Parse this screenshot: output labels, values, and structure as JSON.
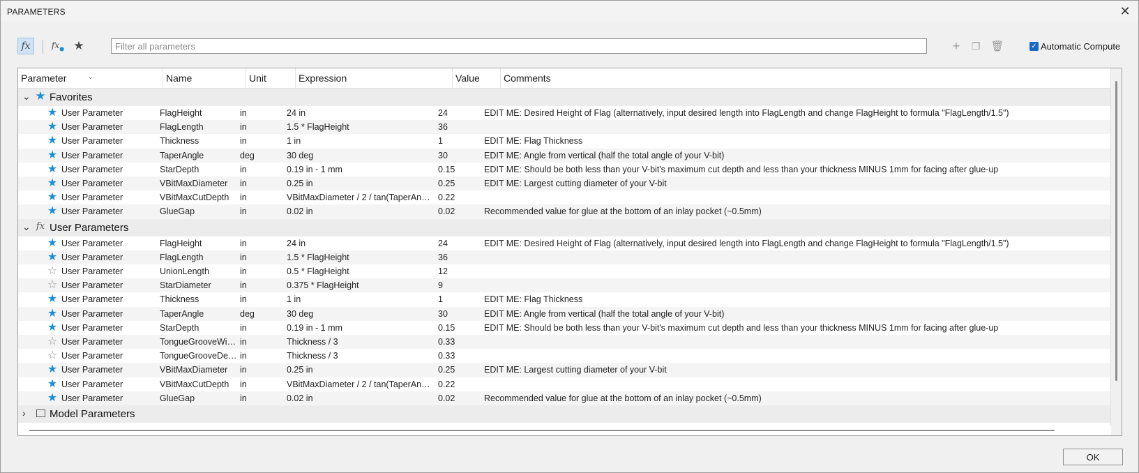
{
  "window": {
    "title": "PARAMETERS"
  },
  "toolbar": {
    "filter_placeholder": "Filter all parameters",
    "auto_compute_label": "Automatic Compute",
    "auto_compute_checked": true
  },
  "columns": [
    "Parameter",
    "Name",
    "Unit",
    "Expression",
    "Value",
    "Comments"
  ],
  "groups": [
    {
      "label": "Favorites",
      "icon": "star-icon",
      "rows": [
        {
          "fav": true,
          "param": "User Parameter",
          "name": "FlagHeight",
          "unit": "in",
          "expr": "24 in",
          "value": "24",
          "comment": "EDIT ME: Desired Height of Flag (alternatively, input desired length into FlagLength and change FlagHeight to formula \"FlagLength/1.5\")"
        },
        {
          "fav": true,
          "param": "User Parameter",
          "name": "FlagLength",
          "unit": "in",
          "expr": "1.5 * FlagHeight",
          "value": "36",
          "comment": ""
        },
        {
          "fav": true,
          "param": "User Parameter",
          "name": "Thickness",
          "unit": "in",
          "expr": "1 in",
          "value": "1",
          "comment": "EDIT ME: Flag Thickness"
        },
        {
          "fav": true,
          "param": "User Parameter",
          "name": "TaperAngle",
          "unit": "deg",
          "expr": "30 deg",
          "value": "30",
          "comment": "EDIT ME: Angle from vertical (half the total angle of your V-bit)"
        },
        {
          "fav": true,
          "param": "User Parameter",
          "name": "StarDepth",
          "unit": "in",
          "expr": "0.19 in - 1 mm",
          "value": "0.15",
          "comment": "EDIT ME: Should be both less than your V-bit's maximum cut depth and less than your thickness MINUS 1mm for facing after glue-up"
        },
        {
          "fav": true,
          "param": "User Parameter",
          "name": "VBitMaxDiameter",
          "unit": "in",
          "expr": "0.25 in",
          "value": "0.25",
          "comment": "EDIT ME: Largest cutting diameter of your V-bit"
        },
        {
          "fav": true,
          "param": "User Parameter",
          "name": "VBitMaxCutDepth",
          "unit": "in",
          "expr": "VBitMaxDiameter / 2 / tan(TaperAngl...",
          "value": "0.22",
          "comment": ""
        },
        {
          "fav": true,
          "param": "User Parameter",
          "name": "GlueGap",
          "unit": "in",
          "expr": "0.02 in",
          "value": "0.02",
          "comment": "Recommended value for glue at the bottom of an inlay pocket (~0.5mm)"
        }
      ]
    },
    {
      "label": "User Parameters",
      "icon": "fx-icon",
      "rows": [
        {
          "fav": true,
          "param": "User Parameter",
          "name": "FlagHeight",
          "unit": "in",
          "expr": "24 in",
          "value": "24",
          "comment": "EDIT ME: Desired Height of Flag (alternatively, input desired length into FlagLength and change FlagHeight to formula \"FlagLength/1.5\")"
        },
        {
          "fav": true,
          "param": "User Parameter",
          "name": "FlagLength",
          "unit": "in",
          "expr": "1.5 * FlagHeight",
          "value": "36",
          "comment": ""
        },
        {
          "fav": false,
          "param": "User Parameter",
          "name": "UnionLength",
          "unit": "in",
          "expr": "0.5 * FlagHeight",
          "value": "12",
          "comment": ""
        },
        {
          "fav": false,
          "param": "User Parameter",
          "name": "StarDiameter",
          "unit": "in",
          "expr": "0.375 * FlagHeight",
          "value": "9",
          "comment": ""
        },
        {
          "fav": true,
          "param": "User Parameter",
          "name": "Thickness",
          "unit": "in",
          "expr": "1 in",
          "value": "1",
          "comment": "EDIT ME: Flag Thickness"
        },
        {
          "fav": true,
          "param": "User Parameter",
          "name": "TaperAngle",
          "unit": "deg",
          "expr": "30 deg",
          "value": "30",
          "comment": "EDIT ME: Angle from vertical (half the total angle of your V-bit)"
        },
        {
          "fav": true,
          "param": "User Parameter",
          "name": "StarDepth",
          "unit": "in",
          "expr": "0.19 in - 1 mm",
          "value": "0.15",
          "comment": "EDIT ME: Should be both less than your V-bit's maximum cut depth and less than your thickness MINUS 1mm for facing after glue-up"
        },
        {
          "fav": false,
          "param": "User Parameter",
          "name": "TongueGrooveWid...",
          "unit": "in",
          "expr": "Thickness / 3",
          "value": "0.33",
          "comment": ""
        },
        {
          "fav": false,
          "param": "User Parameter",
          "name": "TongueGrooveDep...",
          "unit": "in",
          "expr": "Thickness / 3",
          "value": "0.33",
          "comment": ""
        },
        {
          "fav": true,
          "param": "User Parameter",
          "name": "VBitMaxDiameter",
          "unit": "in",
          "expr": "0.25 in",
          "value": "0.25",
          "comment": "EDIT ME: Largest cutting diameter of your V-bit"
        },
        {
          "fav": true,
          "param": "User Parameter",
          "name": "VBitMaxCutDepth",
          "unit": "in",
          "expr": "VBitMaxDiameter / 2 / tan(TaperAngl...",
          "value": "0.22",
          "comment": ""
        },
        {
          "fav": true,
          "param": "User Parameter",
          "name": "GlueGap",
          "unit": "in",
          "expr": "0.02 in",
          "value": "0.02",
          "comment": "Recommended value for glue at the bottom of an inlay pocket (~0.5mm)"
        }
      ]
    },
    {
      "label": "Model Parameters",
      "icon": "model-icon",
      "collapsed": true,
      "rows": []
    }
  ],
  "footer": {
    "ok_label": "OK"
  }
}
